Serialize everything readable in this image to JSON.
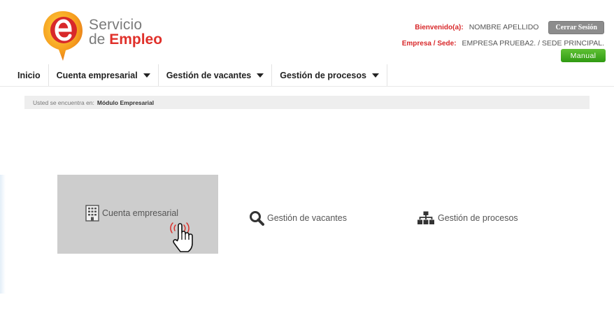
{
  "logo": {
    "line1": "Servicio",
    "line2_a": "de",
    "line2_b": "Empleo",
    "icon": "e-logo-icon"
  },
  "header": {
    "welcome_label": "Bienvenido(a):",
    "user_name": "NOMBRE APELLIDO",
    "logout_label": "Cerrar Sesión",
    "company_label": "Empresa / Sede:",
    "company_value": "EMPRESA PRUEBA2. / SEDE PRINCIPAL.",
    "manual_label": "Manual"
  },
  "nav": {
    "items": [
      {
        "label": "Inicio"
      },
      {
        "label": "Cuenta empresarial"
      },
      {
        "label": "Gestión de vacantes"
      },
      {
        "label": "Gestión de procesos"
      }
    ]
  },
  "breadcrumb": {
    "prefix": "Usted se encuentra en:",
    "current": "Módulo Empresarial"
  },
  "modules": [
    {
      "label": "Cuenta empresarial",
      "icon": "building-icon",
      "selected": true
    },
    {
      "label": "Gestión de vacantes",
      "icon": "search-icon"
    },
    {
      "label": "Gestión de procesos",
      "icon": "sitemap-icon"
    }
  ],
  "colors": {
    "brand_red": "#e0302a",
    "brand_orange": "#f59a1c",
    "manual_green": "#3fa71b",
    "tile_gray": "#cdcdcd"
  }
}
